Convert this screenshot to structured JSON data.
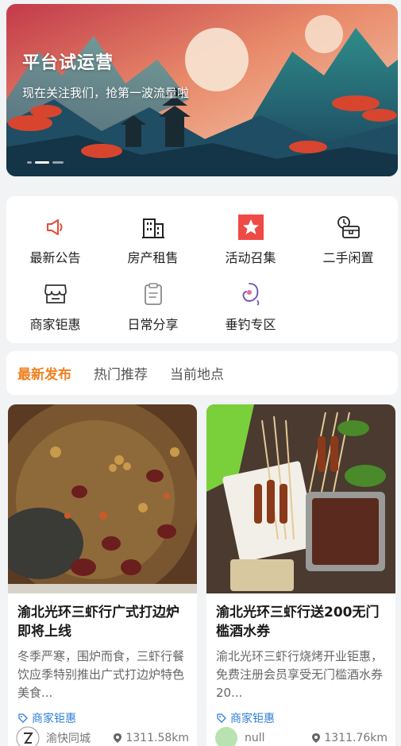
{
  "banner": {
    "title": "平台试运营",
    "subtitle": "现在关注我们，抢第一波流量啦"
  },
  "categories": [
    {
      "label": "最新公告",
      "icon": "megaphone-icon",
      "color": "#e24a3b"
    },
    {
      "label": "房产租售",
      "icon": "building-icon",
      "color": "#222222"
    },
    {
      "label": "活动召集",
      "icon": "star-icon",
      "color": "#ef4a45"
    },
    {
      "label": "二手闲置",
      "icon": "alarm-box-icon",
      "color": "#222222"
    },
    {
      "label": "商家钜惠",
      "icon": "store-icon",
      "color": "#333333"
    },
    {
      "label": "日常分享",
      "icon": "clipboard-icon",
      "color": "#888888"
    },
    {
      "label": "垂钓专区",
      "icon": "fishing-hook-icon",
      "color": "#6a4fb8"
    }
  ],
  "tabs": [
    "最新发布",
    "热门推荐",
    "当前地点"
  ],
  "posts": [
    {
      "title": "渝北光环三虾行广式打边炉即将上线",
      "desc": "冬季严寒，围炉而食，三虾行餐饮应季特别推出广式打边炉特色美食...",
      "tag": "商家钜惠",
      "author": "渝快同城",
      "distance": "1311.58km"
    },
    {
      "title": "渝北光环三虾行送200无门槛酒水券",
      "desc": "渝北光环三虾行烧烤开业钜惠，免费注册会员享受无门槛酒水券20...",
      "tag": "商家钜惠",
      "author": "null",
      "distance": "1311.76km"
    }
  ],
  "colors": {
    "accent": "#f08020",
    "tag": "#2f7fd8"
  }
}
